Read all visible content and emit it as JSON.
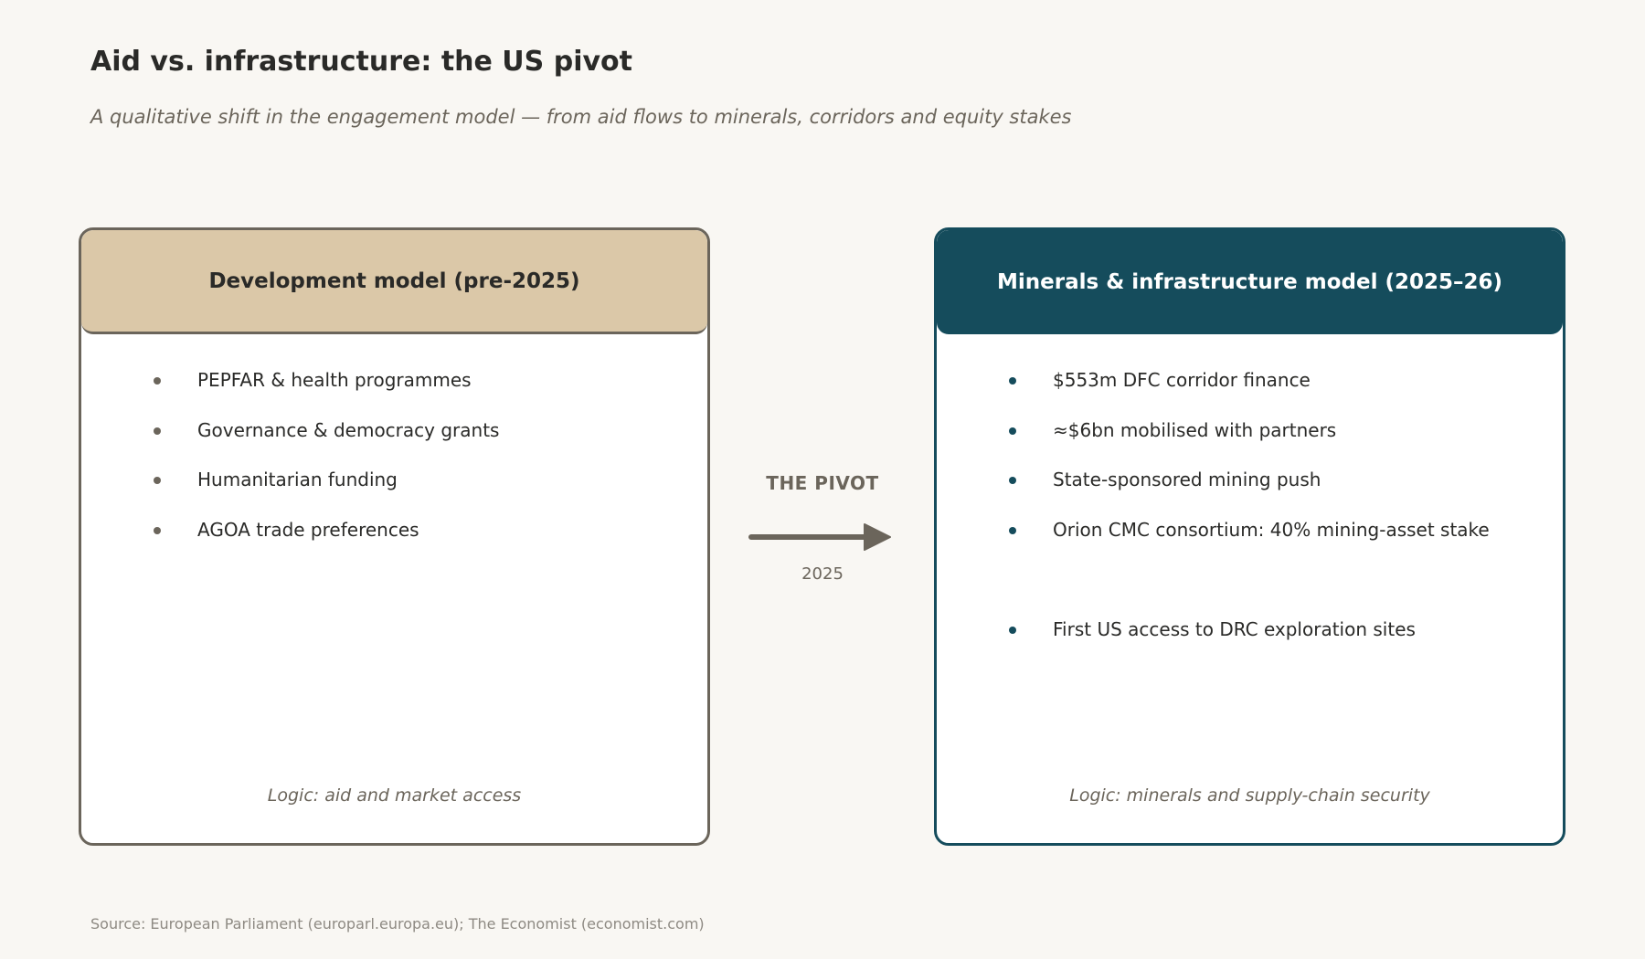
{
  "title": "Aid vs. infrastructure: the US pivot",
  "subtitle": "A qualitative shift in the engagement model — from aid flows to minerals, corridors and equity stakes",
  "left_panel": {
    "header": "Development model (pre-2025)",
    "items": [
      "PEPFAR & health programmes",
      "Governance & democracy grants",
      "Humanitarian funding",
      "AGOA trade preferences"
    ],
    "logic": "Logic: aid and market access"
  },
  "pivot": {
    "label": "THE PIVOT",
    "year": "2025"
  },
  "right_panel": {
    "header": "Minerals & infrastructure model (2025–26)",
    "items": [
      "$553m DFC corridor finance",
      "≈$6bn mobilised with partners",
      "State-sponsored mining push",
      "Orion CMC consortium: 40% mining-asset stake",
      "First US access to DRC exploration sites"
    ],
    "logic": "Logic: minerals and supply-chain security"
  },
  "source": "Source: European Parliament (europarl.europa.eu); The Economist (economist.com)",
  "colors": {
    "background": "#f9f7f3",
    "left_accent": "#6b655b",
    "left_header": "#dbc8a8",
    "right_accent": "#154c5c"
  }
}
